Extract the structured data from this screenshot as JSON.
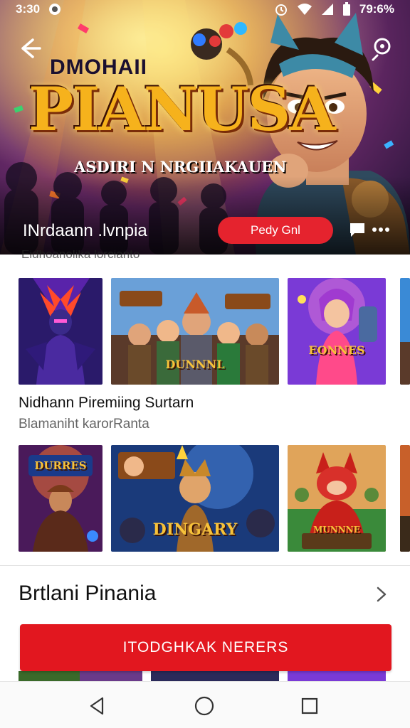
{
  "status_bar": {
    "time": "3:30",
    "battery": "79:6%",
    "icons": [
      "notification-icon",
      "alarm-icon",
      "wifi-icon",
      "signal-icon",
      "battery-icon"
    ]
  },
  "hero": {
    "brand": "DMOHAII",
    "title": "PIANUSA",
    "subtitle": "ASDIRI N NRGIIAKAUEN",
    "name": "INrdaann .lvnpia",
    "play_label": "Pedy Gnl",
    "icons": [
      "back-arrow-icon",
      "search-icon",
      "chat-icon",
      "more-dots-icon"
    ]
  },
  "section_top": {
    "clipped_label": "Eidhoanolika lorcianto",
    "cards": [
      {
        "art": "purple-warrior",
        "caption": ""
      },
      {
        "art": "hero-crowd",
        "caption": "DUNNNL"
      },
      {
        "art": "pink-heroine",
        "caption": "EONNES"
      },
      {
        "art": "peek",
        "caption": ""
      }
    ]
  },
  "section_second": {
    "title": "Nidhann Piremiing Surtarn",
    "subtitle": "Blamaniht karorRanta",
    "cards": [
      {
        "art": "dark-mage",
        "caption": "DURRES"
      },
      {
        "art": "jester-crowd",
        "caption": "DINGARY"
      },
      {
        "art": "red-imp",
        "caption": "MUNNNE"
      },
      {
        "art": "peek",
        "caption": ""
      }
    ]
  },
  "section_third": {
    "title": "Brtlani Pinania",
    "cta_label": "ITODGHKAK NERERS"
  },
  "colors": {
    "accent_red": "#e2171f",
    "pill_red": "#e5232e",
    "title_gold": "#f6b21c"
  },
  "nav": {
    "items": [
      "back-triangle-icon",
      "home-circle-icon",
      "recents-square-icon"
    ]
  }
}
